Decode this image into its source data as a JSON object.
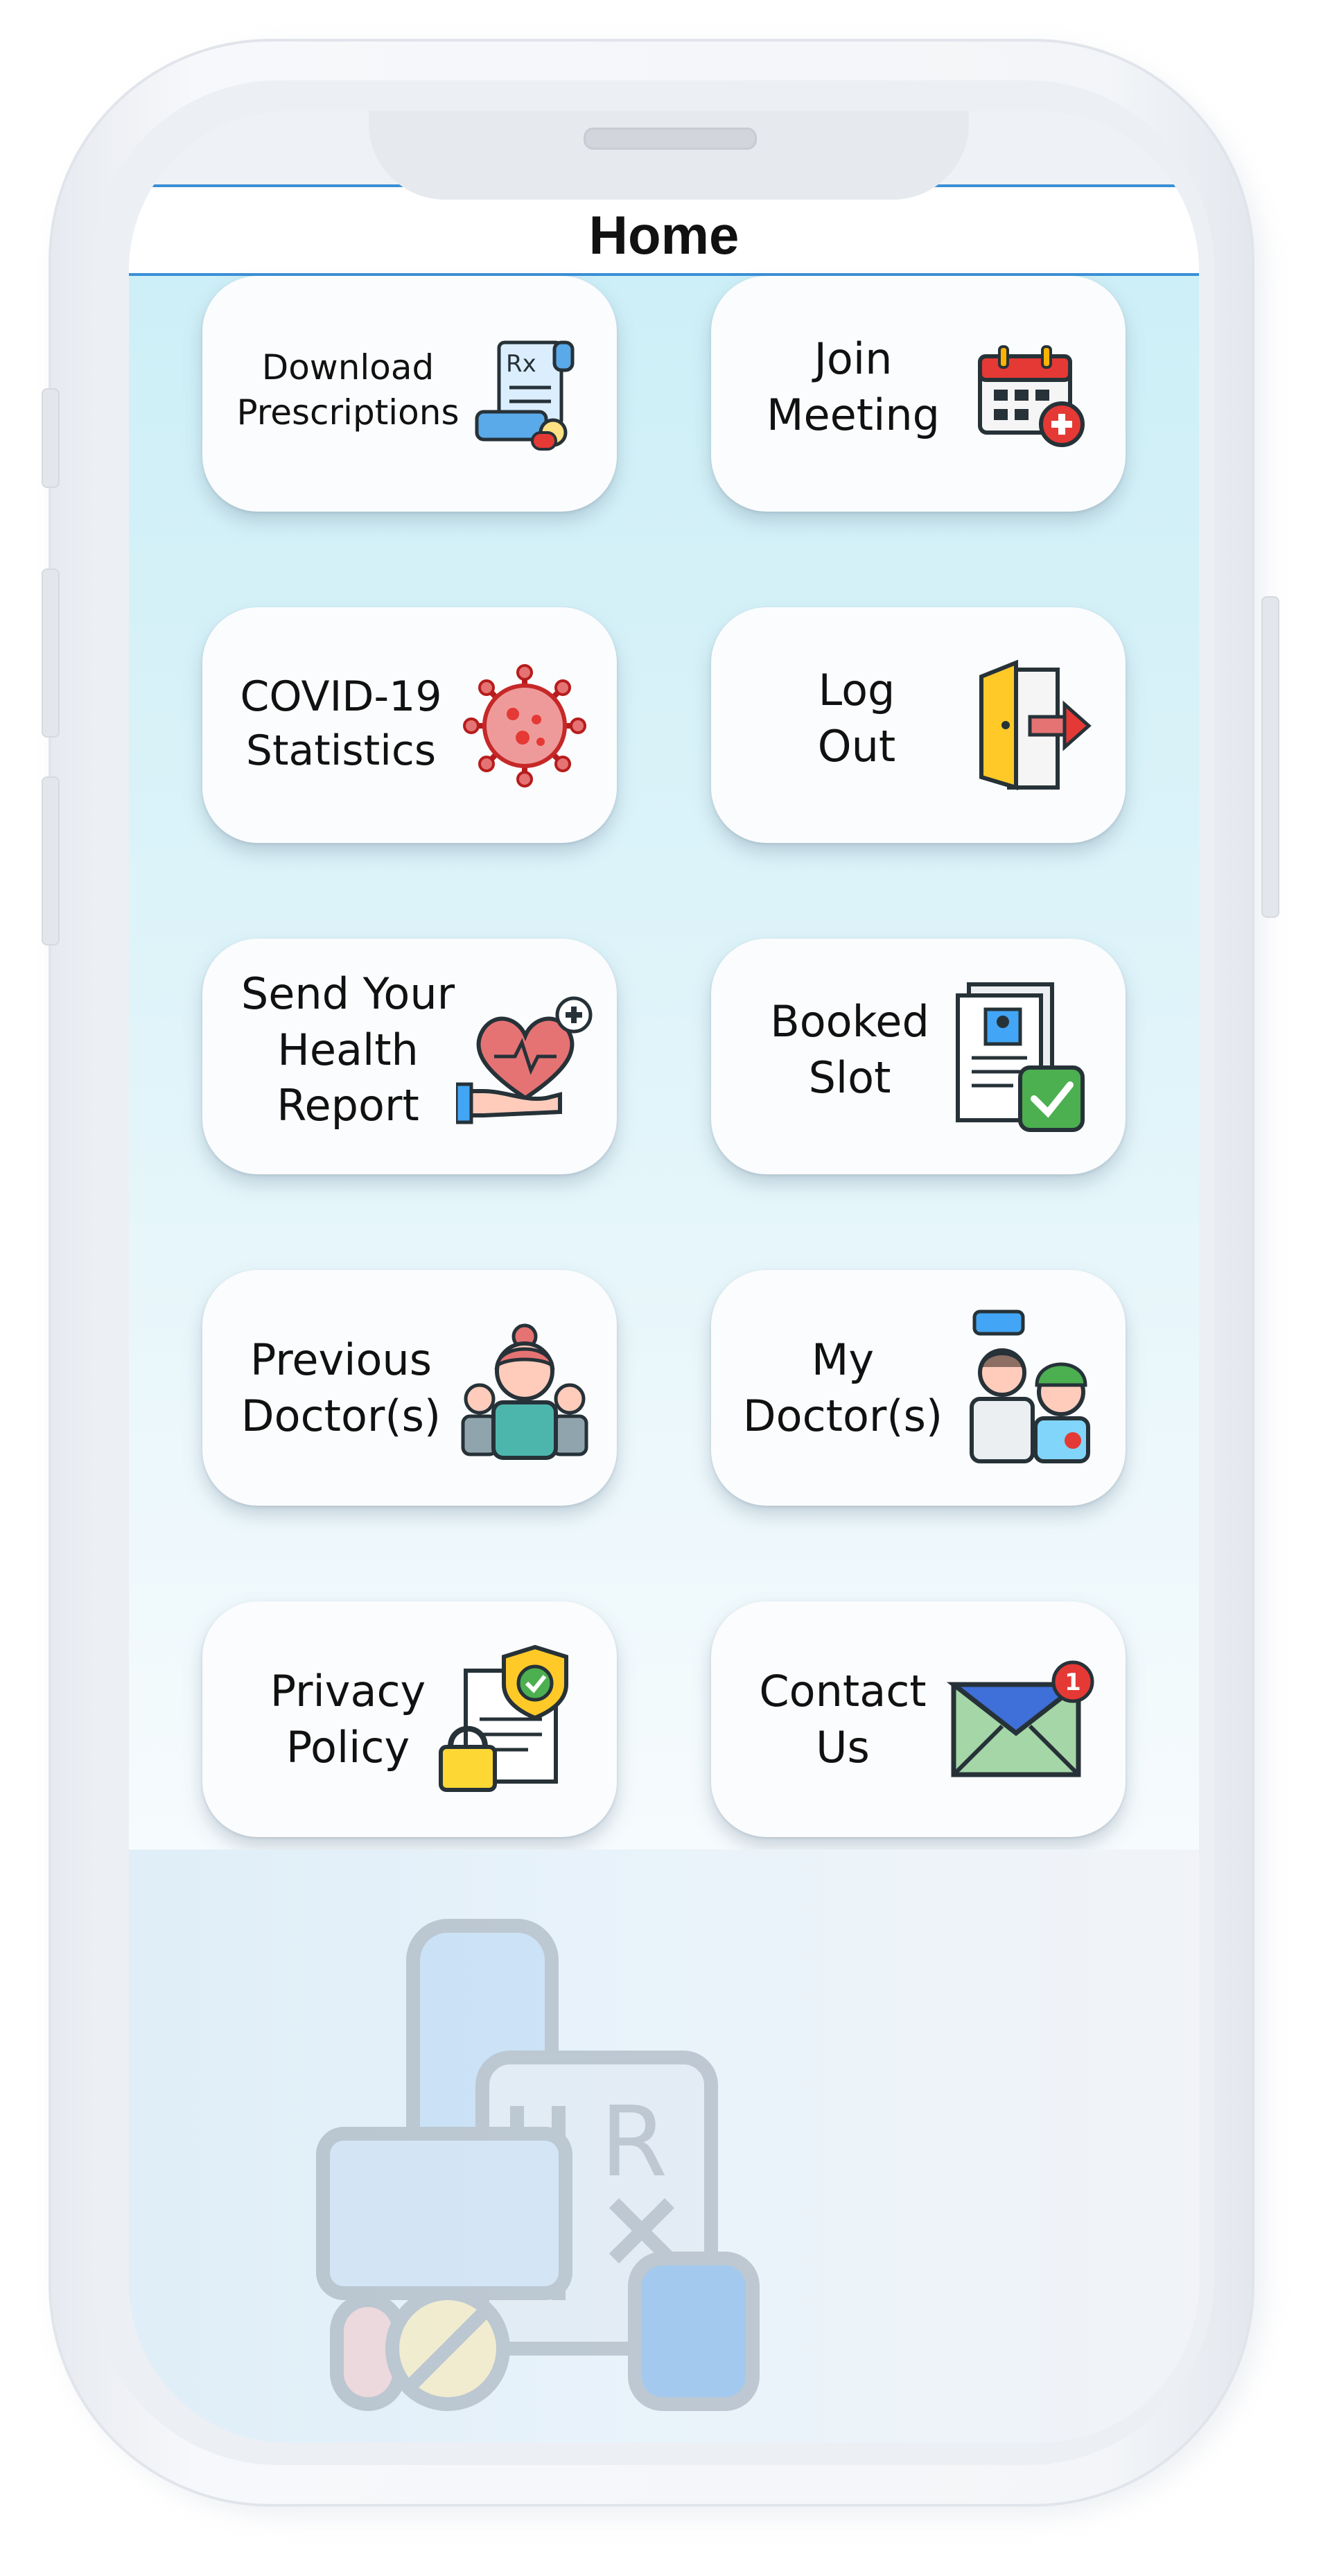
{
  "header": {
    "title": "Home"
  },
  "tiles": [
    {
      "label": "Download\nPrescriptions",
      "icon": "prescription-icon"
    },
    {
      "label": "Join\nMeeting",
      "icon": "calendar-add-icon"
    },
    {
      "label": "COVID-19\nStatistics",
      "icon": "virus-icon"
    },
    {
      "label": "Log\nOut",
      "icon": "logout-door-icon"
    },
    {
      "label": "Send Your\nHealth\nReport",
      "icon": "heart-hand-icon"
    },
    {
      "label": "Booked\nSlot",
      "icon": "document-check-icon"
    },
    {
      "label": "Previous\nDoctor(s)",
      "icon": "doctors-group-icon"
    },
    {
      "label": "My\nDoctor(s)",
      "icon": "doctor-patient-icon"
    },
    {
      "label": "Privacy\nPolicy",
      "icon": "privacy-shield-icon"
    },
    {
      "label": "Contact\nUs",
      "icon": "mail-notification-icon"
    }
  ],
  "badges": {
    "mail_count": "1"
  },
  "watermark": {
    "icon": "prescription-watermark-icon"
  },
  "colors": {
    "header_border": "#3a8fd6",
    "tile_background": "#fbfcfd",
    "content_gradient_top": "#cdeff7"
  }
}
